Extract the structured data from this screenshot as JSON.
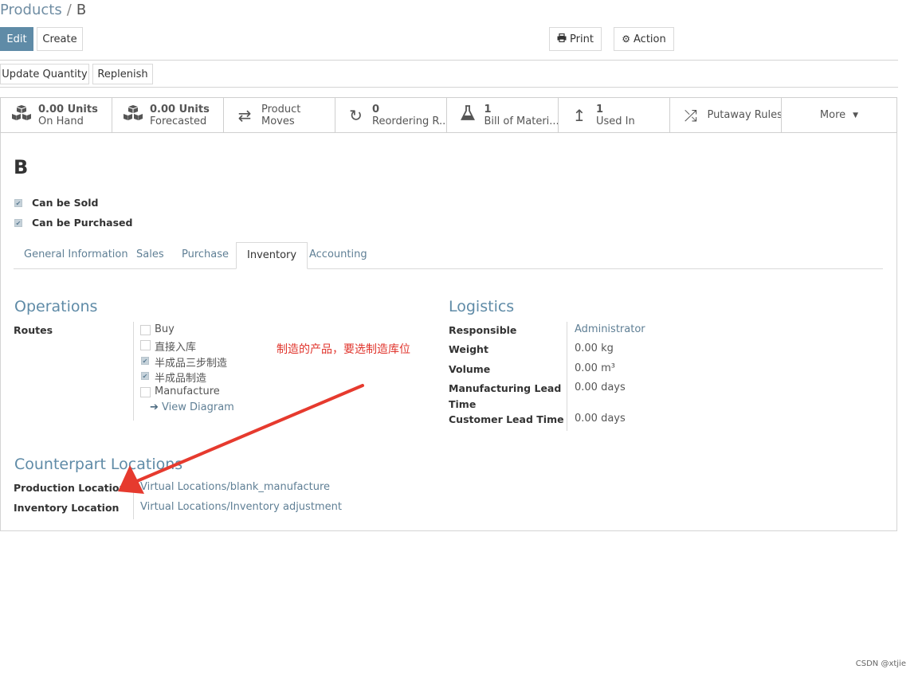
{
  "breadcrumb": {
    "parent": "Products",
    "separator": "/",
    "current": "B"
  },
  "toolbar": {
    "edit": "Edit",
    "create": "Create",
    "print": "Print",
    "action": "Action",
    "update_quantity": "Update Quantity",
    "replenish": "Replenish"
  },
  "stats": {
    "on_hand_value": "0.00 Units",
    "on_hand_label": "On Hand",
    "forecast_value": "0.00 Units",
    "forecast_label": "Forecasted",
    "moves_line1": "Product",
    "moves_line2": "Moves",
    "reorder_value": "0",
    "reorder_label": "Reordering R...",
    "bom_value": "1",
    "bom_label": "Bill of Materi...",
    "used_value": "1",
    "used_label": "Used In",
    "putaway": "Putaway Rules",
    "more": "More"
  },
  "product": {
    "name": "B",
    "can_be_sold": "Can be Sold",
    "can_be_purchased": "Can be Purchased"
  },
  "tabs": [
    "General Information",
    "Sales",
    "Purchase",
    "Inventory",
    "Accounting"
  ],
  "operations": {
    "title": "Operations",
    "routes_label": "Routes",
    "routes": [
      {
        "label": "Buy",
        "checked": false
      },
      {
        "label": "直接入库",
        "checked": false
      },
      {
        "label": "半成品三步制造",
        "checked": true
      },
      {
        "label": "半成品制造",
        "checked": true
      },
      {
        "label": "Manufacture",
        "checked": false
      }
    ],
    "view_diagram": "View Diagram"
  },
  "logistics": {
    "title": "Logistics",
    "responsible_label": "Responsible",
    "responsible": "Administrator",
    "weight_label": "Weight",
    "weight": "0.00 kg",
    "volume_label": "Volume",
    "volume": "0.00 m³",
    "mfg_lead_label_1": "Manufacturing Lead",
    "mfg_lead_label_2": "Time",
    "mfg_lead": "0.00 days",
    "cust_lead_label": "Customer Lead Time",
    "cust_lead": "0.00 days"
  },
  "counterpart": {
    "title": "Counterpart Locations",
    "production_label": "Production Location",
    "production": "Virtual Locations/blank_manufacture",
    "inventory_label": "Inventory Location",
    "inventory": "Virtual Locations/Inventory adjustment"
  },
  "annotation": "制造的产品，要选制造库位",
  "annotation_color": "#e0342c",
  "accent_color": "#5f8ba7",
  "watermark": "CSDN @xtjie"
}
